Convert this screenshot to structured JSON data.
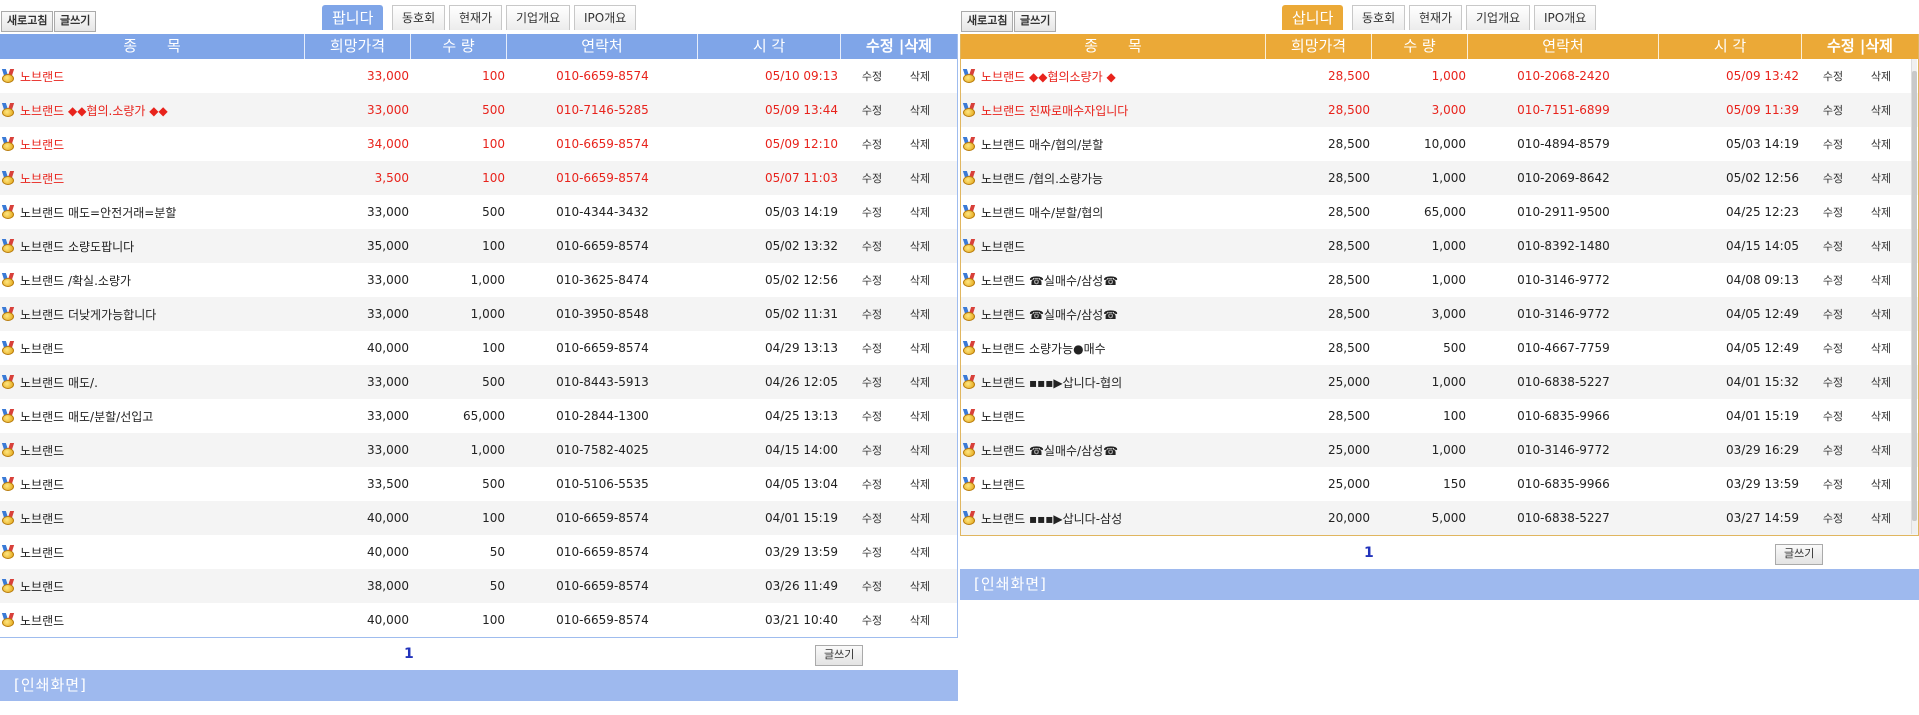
{
  "sell": {
    "refresh_label": "새로고침",
    "write_label": "글쓰기",
    "tabs": [
      "팝니다",
      "동호회",
      "현재가",
      "기업개요",
      "IPO개요"
    ],
    "headers": [
      "종　　목",
      "희망가격",
      "수 량",
      "연락처",
      "시 각",
      "수정 |삭제"
    ],
    "edit_label": "수정",
    "delete_label": "삭제",
    "rows": [
      {
        "name": "노브랜드",
        "price": "33,000",
        "qty": "100",
        "phone": "010-6659-8574",
        "time": "05/10 09:13",
        "hot": true
      },
      {
        "name": "노브랜드 ◆◆협의.소량가 ◆◆",
        "price": "33,000",
        "qty": "500",
        "phone": "010-7146-5285",
        "time": "05/09 13:44",
        "hot": true
      },
      {
        "name": "노브랜드",
        "price": "34,000",
        "qty": "100",
        "phone": "010-6659-8574",
        "time": "05/09 12:10",
        "hot": true
      },
      {
        "name": "노브랜드",
        "price": "3,500",
        "qty": "100",
        "phone": "010-6659-8574",
        "time": "05/07 11:03",
        "hot": true
      },
      {
        "name": "노브랜드 매도=안전거래=분할",
        "price": "33,000",
        "qty": "500",
        "phone": "010-4344-3432",
        "time": "05/03 14:19",
        "hot": false
      },
      {
        "name": "노브랜드 소량도팝니다",
        "price": "35,000",
        "qty": "100",
        "phone": "010-6659-8574",
        "time": "05/02 13:32",
        "hot": false
      },
      {
        "name": "노브랜드 /확실.소량가",
        "price": "33,000",
        "qty": "1,000",
        "phone": "010-3625-8474",
        "time": "05/02 12:56",
        "hot": false
      },
      {
        "name": "노브랜드 더낮게가능합니다",
        "price": "33,000",
        "qty": "1,000",
        "phone": "010-3950-8548",
        "time": "05/02 11:31",
        "hot": false
      },
      {
        "name": "노브랜드",
        "price": "40,000",
        "qty": "100",
        "phone": "010-6659-8574",
        "time": "04/29 13:13",
        "hot": false
      },
      {
        "name": "노브랜드 매도/.",
        "price": "33,000",
        "qty": "500",
        "phone": "010-8443-5913",
        "time": "04/26 12:05",
        "hot": false
      },
      {
        "name": "노브랜드 매도/분할/선입고",
        "price": "33,000",
        "qty": "65,000",
        "phone": "010-2844-1300",
        "time": "04/25 13:13",
        "hot": false
      },
      {
        "name": "노브랜드",
        "price": "33,000",
        "qty": "1,000",
        "phone": "010-7582-4025",
        "time": "04/15 14:00",
        "hot": false
      },
      {
        "name": "노브랜드",
        "price": "33,500",
        "qty": "500",
        "phone": "010-5106-5535",
        "time": "04/05 13:04",
        "hot": false
      },
      {
        "name": "노브랜드",
        "price": "40,000",
        "qty": "100",
        "phone": "010-6659-8574",
        "time": "04/01 15:19",
        "hot": false
      },
      {
        "name": "노브랜드",
        "price": "40,000",
        "qty": "50",
        "phone": "010-6659-8574",
        "time": "03/29 13:59",
        "hot": false
      },
      {
        "name": "노브랜드",
        "price": "38,000",
        "qty": "50",
        "phone": "010-6659-8574",
        "time": "03/26 11:49",
        "hot": false
      },
      {
        "name": "노브랜드",
        "price": "40,000",
        "qty": "100",
        "phone": "010-6659-8574",
        "time": "03/21 10:40",
        "hot": false
      }
    ],
    "page": "1",
    "write_bottom_label": "글쓰기",
    "print_label": "[인쇄화면]"
  },
  "buy": {
    "refresh_label": "새로고침",
    "write_label": "글쓰기",
    "tabs": [
      "삽니다",
      "동호회",
      "현재가",
      "기업개요",
      "IPO개요"
    ],
    "headers": [
      "종　　목",
      "희망가격",
      "수 량",
      "연락처",
      "시 각",
      "수정 |삭제"
    ],
    "edit_label": "수정",
    "delete_label": "삭제",
    "rows": [
      {
        "name": "노브랜드 ◆◆협의소량가 ◆",
        "price": "28,500",
        "qty": "1,000",
        "phone": "010-2068-2420",
        "time": "05/09 13:42",
        "hot": true
      },
      {
        "name": "노브랜드 진짜로매수자입니다",
        "price": "28,500",
        "qty": "3,000",
        "phone": "010-7151-6899",
        "time": "05/09 11:39",
        "hot": true
      },
      {
        "name": "노브랜드 매수/협의/분할",
        "price": "28,500",
        "qty": "10,000",
        "phone": "010-4894-8579",
        "time": "05/03 14:19",
        "hot": false
      },
      {
        "name": "노브랜드 /협의.소량가능",
        "price": "28,500",
        "qty": "1,000",
        "phone": "010-2069-8642",
        "time": "05/02 12:56",
        "hot": false
      },
      {
        "name": "노브랜드 매수/분할/협의",
        "price": "28,500",
        "qty": "65,000",
        "phone": "010-2911-9500",
        "time": "04/25 12:23",
        "hot": false
      },
      {
        "name": "노브랜드",
        "price": "28,500",
        "qty": "1,000",
        "phone": "010-8392-1480",
        "time": "04/15 14:05",
        "hot": false
      },
      {
        "name": "노브랜드 ☎실매수/삼성☎",
        "price": "28,500",
        "qty": "1,000",
        "phone": "010-3146-9772",
        "time": "04/08 09:13",
        "hot": false
      },
      {
        "name": "노브랜드 ☎실매수/삼성☎",
        "price": "28,500",
        "qty": "3,000",
        "phone": "010-3146-9772",
        "time": "04/05 12:49",
        "hot": false
      },
      {
        "name": "노브랜드 소량가능●매수",
        "price": "28,500",
        "qty": "500",
        "phone": "010-4667-7759",
        "time": "04/05 12:49",
        "hot": false
      },
      {
        "name": "노브랜드 ▪▪▪▶삽니다-협의",
        "price": "25,000",
        "qty": "1,000",
        "phone": "010-6838-5227",
        "time": "04/01 15:32",
        "hot": false
      },
      {
        "name": "노브랜드",
        "price": "28,500",
        "qty": "100",
        "phone": "010-6835-9966",
        "time": "04/01 15:19",
        "hot": false
      },
      {
        "name": "노브랜드 ☎실매수/삼성☎",
        "price": "25,000",
        "qty": "1,000",
        "phone": "010-3146-9772",
        "time": "03/29 16:29",
        "hot": false
      },
      {
        "name": "노브랜드",
        "price": "25,000",
        "qty": "150",
        "phone": "010-6835-9966",
        "time": "03/29 13:59",
        "hot": false
      },
      {
        "name": "노브랜드 ▪▪▪▶삽니다-삼성",
        "price": "20,000",
        "qty": "5,000",
        "phone": "010-6838-5227",
        "time": "03/27 14:59",
        "hot": false
      }
    ],
    "page": "1",
    "write_bottom_label": "글쓰기",
    "print_label": "[인쇄화면]"
  }
}
